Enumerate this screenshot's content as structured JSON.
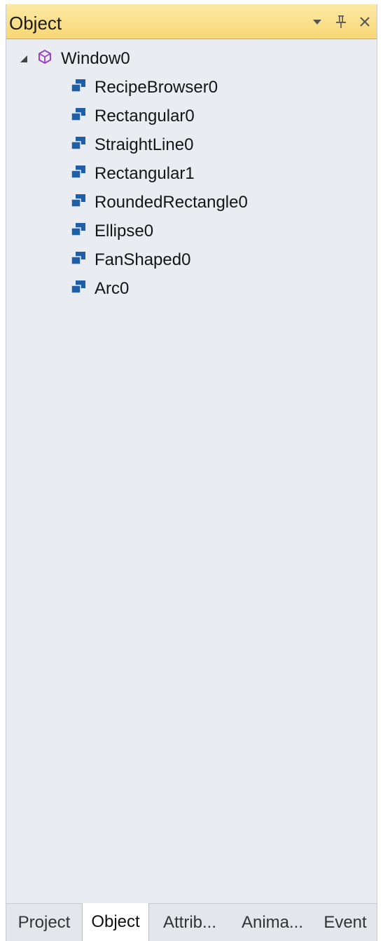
{
  "panel": {
    "title": "Object",
    "controls": [
      {
        "name": "dropdown-icon"
      },
      {
        "name": "pin-icon"
      },
      {
        "name": "close-icon"
      }
    ]
  },
  "tree": {
    "root": {
      "label": "Window0",
      "icon": "window-cube-icon",
      "expanded": true
    },
    "children": [
      {
        "label": "RecipeBrowser0",
        "icon": "object-icon"
      },
      {
        "label": "Rectangular0",
        "icon": "object-icon"
      },
      {
        "label": "StraightLine0",
        "icon": "object-icon"
      },
      {
        "label": "Rectangular1",
        "icon": "object-icon"
      },
      {
        "label": "RoundedRectangle0",
        "icon": "object-icon"
      },
      {
        "label": "Ellipse0",
        "icon": "object-icon"
      },
      {
        "label": "FanShaped0",
        "icon": "object-icon"
      },
      {
        "label": "Arc0",
        "icon": "object-icon"
      }
    ]
  },
  "tabs": [
    {
      "label": "Project",
      "active": false
    },
    {
      "label": "Object",
      "active": true
    },
    {
      "label": "Attrib...",
      "active": false
    },
    {
      "label": "Anima...",
      "active": false
    },
    {
      "label": "Event",
      "active": false
    }
  ],
  "colors": {
    "titlebar": "#f8d775",
    "panel_bg": "#e9edf2",
    "object_icon": "#1f5fa8",
    "window_icon": "#9b44c4"
  }
}
